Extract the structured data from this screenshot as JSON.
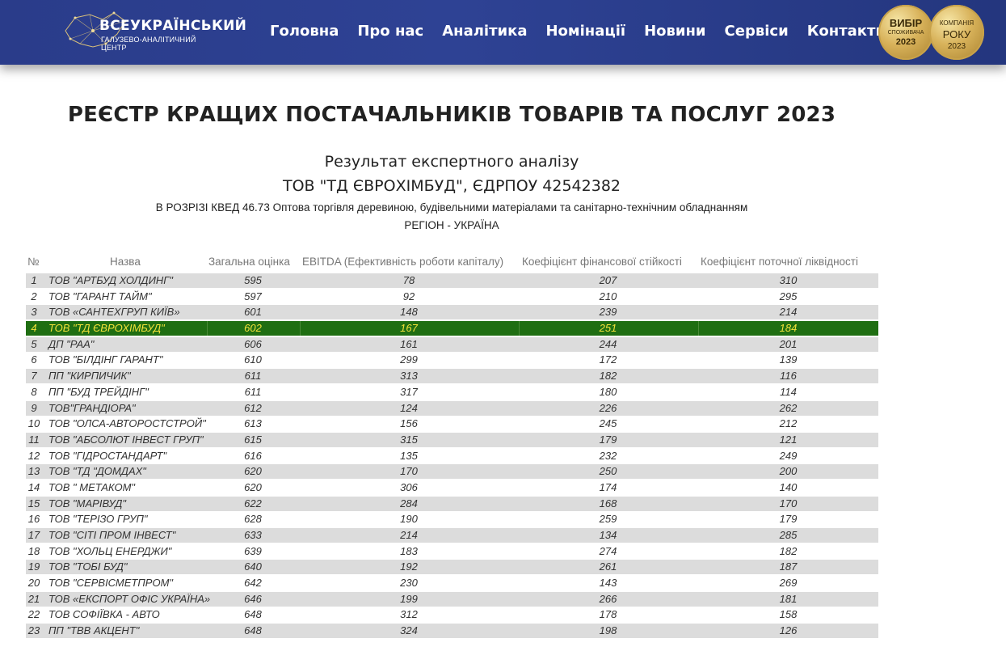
{
  "header": {
    "logo_line1": "ВСЕУКРАЇНСЬКИЙ",
    "logo_line2": "ГАЛУЗЕВО-АНАЛІТИЧНИЙ ЦЕНТР",
    "nav": [
      "Головна",
      "Про нас",
      "Аналітика",
      "Номінації",
      "Новини",
      "Сервіси",
      "Контакти"
    ],
    "badge1": {
      "line1": "ВИБІР",
      "line2": "СПОЖИВАЧА",
      "line3": "2023"
    },
    "badge2": {
      "line1": "КОМПАНІЯ",
      "line2": "РОКУ",
      "line3": "2023"
    }
  },
  "page": {
    "title": "РЕЄСТР КРАЩИХ ПОСТАЧАЛЬНИКІВ ТОВАРІВ ТА ПОСЛУГ 2023",
    "subtitle1": "Результат експертного аналізу",
    "subtitle2": "ТОВ \"ТД ЄВРОХІМБУД\", ЄДРПОУ 42542382",
    "subtitle3": "В РОЗРІЗІ КВЕД 46.73 Оптова торгівля деревиною, будівельними матеріалами та санітарно-технічним обладнанням",
    "subtitle4": "РЕГІОН - УКРАЇНА"
  },
  "table": {
    "headers": [
      "№",
      "Назва",
      "Загальна оцінка",
      "EBITDA (Ефективність роботи капіталу)",
      "Коефіцієнт фінансової стійкості",
      "Коефіцієнт поточної ліквідності"
    ],
    "highlight_row": 4,
    "highlight_color": "#1f6e12",
    "rows": [
      [
        "1",
        "ТОВ \"АРТБУД ХОЛДИНГ\"",
        "595",
        "78",
        "207",
        "310"
      ],
      [
        "2",
        "ТОВ \"ГАРАНТ ТАЙМ\"",
        "597",
        "92",
        "210",
        "295"
      ],
      [
        "3",
        "ТОВ «САНТЕХГРУП КИЇВ»",
        "601",
        "148",
        "239",
        "214"
      ],
      [
        "4",
        "ТОВ \"ТД ЄВРОХІМБУД\"",
        "602",
        "167",
        "251",
        "184"
      ],
      [
        "5",
        "ДП \"РАА\"",
        "606",
        "161",
        "244",
        "201"
      ],
      [
        "6",
        "ТОВ \"БІЛДІНГ ГАРАНТ\"",
        "610",
        "299",
        "172",
        "139"
      ],
      [
        "7",
        "ПП \"КИРПИЧИК\"",
        "611",
        "313",
        "182",
        "116"
      ],
      [
        "8",
        "ПП \"БУД ТРЕЙДІНГ\"",
        "611",
        "317",
        "180",
        "114"
      ],
      [
        "9",
        "ТОВ\"ГРАНДІОРА\"",
        "612",
        "124",
        "226",
        "262"
      ],
      [
        "10",
        "ТОВ \"ОЛСА-АВТОРОСТСТРОЙ\"",
        "613",
        "156",
        "245",
        "212"
      ],
      [
        "11",
        "ТОВ \"АБСОЛЮТ ІНВЕСТ ГРУП\"",
        "615",
        "315",
        "179",
        "121"
      ],
      [
        "12",
        "ТОВ \"ГІДРОСТАНДАРТ\"",
        "616",
        "135",
        "232",
        "249"
      ],
      [
        "13",
        "ТОВ \"ТД \"ДОМДАХ\"",
        "620",
        "170",
        "250",
        "200"
      ],
      [
        "14",
        "ТОВ \" МЕТАКОМ\"",
        "620",
        "306",
        "174",
        "140"
      ],
      [
        "15",
        "ТОВ \"МАРІВУД\"",
        "622",
        "284",
        "168",
        "170"
      ],
      [
        "16",
        "ТОВ \"ТЕРІЗО ГРУП\"",
        "628",
        "190",
        "259",
        "179"
      ],
      [
        "17",
        "ТОВ \"СІТІ ПРОМ ІНВЕСТ\"",
        "633",
        "214",
        "134",
        "285"
      ],
      [
        "18",
        "ТОВ \"ХОЛЬЦ ЕНЕРДЖИ\"",
        "639",
        "183",
        "274",
        "182"
      ],
      [
        "19",
        "ТОВ \"ТОБІ БУД\"",
        "640",
        "192",
        "261",
        "187"
      ],
      [
        "20",
        "ТОВ \"СЕРВІСМЕТПРОМ\"",
        "642",
        "230",
        "143",
        "269"
      ],
      [
        "21",
        "ТОВ «ЕКСПОРТ ОФІС УКРАЇНА»",
        "646",
        "199",
        "266",
        "181"
      ],
      [
        "22",
        "ТОВ СОФІЇВКА - АВТО",
        "648",
        "312",
        "178",
        "158"
      ],
      [
        "23",
        "ПП \"ТВВ АКЦЕНТ\"",
        "648",
        "324",
        "198",
        "126"
      ]
    ]
  }
}
